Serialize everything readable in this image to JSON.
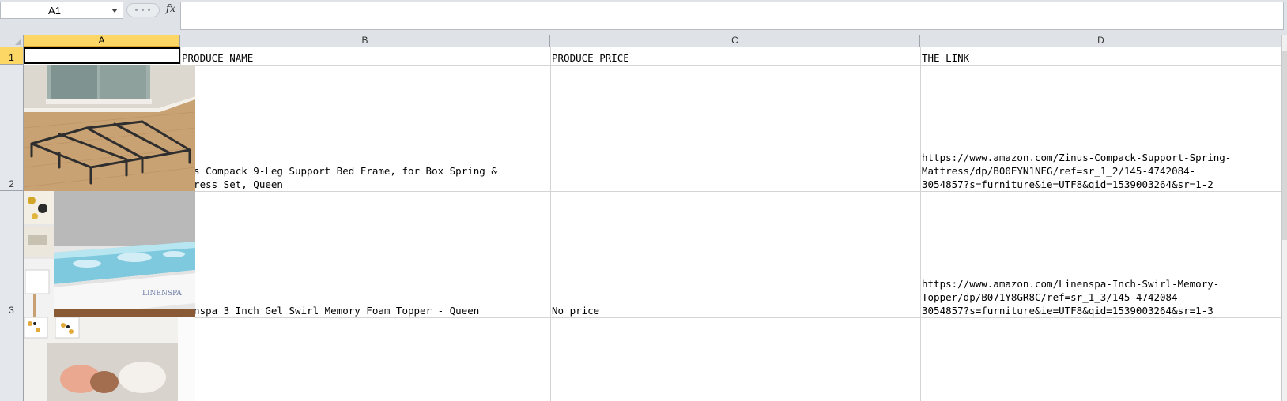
{
  "formula_bar": {
    "name_box": "A1",
    "fx_label": "fx",
    "formula": ""
  },
  "columns": [
    "A",
    "B",
    "C",
    "D"
  ],
  "rows": [
    "1",
    "2",
    "3"
  ],
  "cells": {
    "B1": "PRODUCE NAME",
    "C1": "PRODUCE PRICE",
    "D1": "THE LINK",
    "B2": "nus Compack 9-Leg Support Bed Frame, for Box Spring &\nttress Set, Queen",
    "C2": "",
    "D2": "https://www.amazon.com/Zinus-Compack-Support-Spring-\nMattress/dp/B00EYN1NEG/ref=sr_1_2/145-4742084-\n3054857?s=furniture&ie=UTF8&qid=1539003264&sr=1-2",
    "B3": "nenspa 3 Inch Gel Swirl Memory Foam Topper - Queen",
    "C3": "No price",
    "D3": "https://www.amazon.com/Linenspa-Inch-Swirl-Memory-\nTopper/dp/B071Y8GR8C/ref=sr_1_3/145-4742084-\n3054857?s=furniture&ie=UTF8&qid=1539003264&sr=1-3"
  },
  "images": {
    "img2_label": "",
    "img3_brand": "LINENSPA"
  },
  "colors": {
    "selected_header": "#fcd765",
    "header_bg": "#dfe3e8",
    "gridline": "#d4d4d4"
  }
}
